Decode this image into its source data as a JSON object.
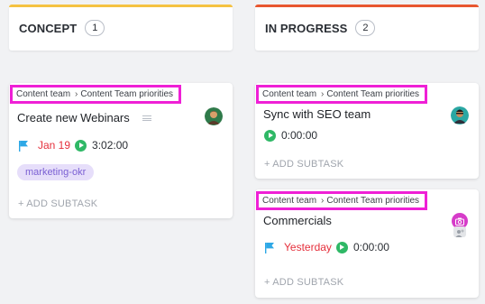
{
  "columns": [
    {
      "title": "CONCEPT",
      "count": "1",
      "accent": "#f5c242",
      "cards": [
        {
          "breadcrumb": {
            "space": "Content team",
            "list": "Content Team priorities"
          },
          "title": "Create new Webinars",
          "due": "Jan 19",
          "time": "3:02:00",
          "tag": "marketing-okr",
          "add_subtask": "+ ADD SUBTASK"
        }
      ]
    },
    {
      "title": "IN PROGRESS",
      "count": "2",
      "accent": "#e8572f",
      "cards": [
        {
          "breadcrumb": {
            "space": "Content team",
            "list": "Content Team priorities"
          },
          "title": "Sync with SEO team",
          "time": "0:00:00",
          "add_subtask": "+ ADD SUBTASK"
        },
        {
          "breadcrumb": {
            "space": "Content team",
            "list": "Content Team priorities"
          },
          "title": "Commercials",
          "due": "Yesterday",
          "time": "0:00:00",
          "add_subtask": "+ ADD SUBTASK"
        }
      ]
    }
  ],
  "colors": {
    "highlight": "#ef20d6",
    "due_overdue": "#e5303c",
    "timer_green": "#2fb866",
    "flag_blue": "#2ea8e6",
    "tag_bg": "#e6defa",
    "tag_text": "#7a5fd3"
  }
}
